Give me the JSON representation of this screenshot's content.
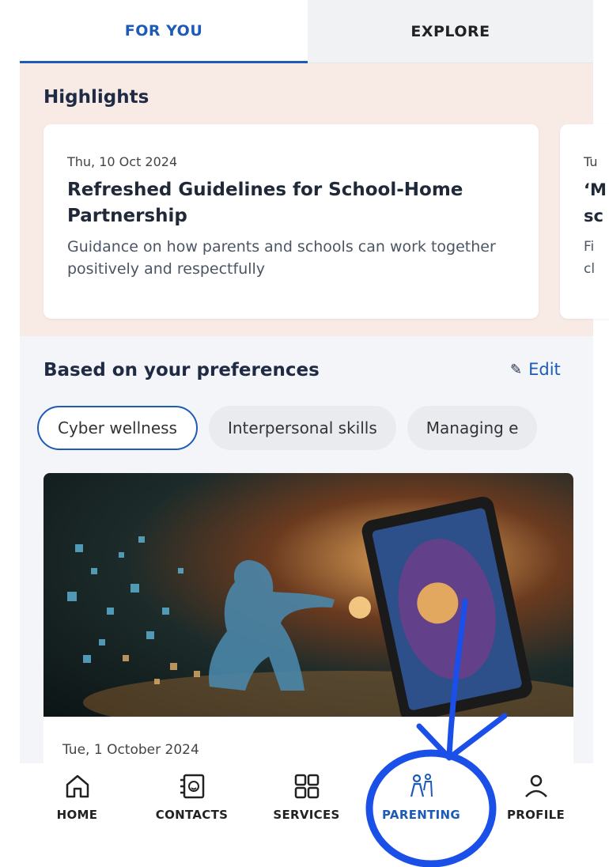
{
  "tabs": [
    {
      "label": "FOR YOU",
      "active": true
    },
    {
      "label": "EXPLORE",
      "active": false
    }
  ],
  "highlights": {
    "title": "Highlights",
    "cards": [
      {
        "date": "Thu, 10 Oct 2024",
        "headline": "Refreshed Guidelines for School-Home Partnership",
        "description": "Guidance on how parents and schools can work together positively and respectfully"
      },
      {
        "date": "Tu",
        "headline": "‘M sc",
        "description": "Fi cl"
      }
    ]
  },
  "preferences": {
    "title": "Based on your preferences",
    "edit_label": "Edit",
    "chips": [
      {
        "label": "Cyber wellness",
        "active": true
      },
      {
        "label": "Interpersonal skills",
        "active": false
      },
      {
        "label": "Managing e",
        "active": false
      }
    ],
    "article": {
      "date": "Tue, 1 October 2024"
    }
  },
  "bottom_nav": [
    {
      "label": "HOME",
      "icon": "home-icon"
    },
    {
      "label": "CONTACTS",
      "icon": "contacts-icon"
    },
    {
      "label": "SERVICES",
      "icon": "services-grid-icon"
    },
    {
      "label": "PARENTING",
      "icon": "parenting-icon",
      "active": true
    },
    {
      "label": "PROFILE",
      "icon": "profile-icon"
    }
  ],
  "colors": {
    "accent": "#1d5bb6",
    "annotation": "#1a4fe8",
    "highlight_bg": "#f8ebe6"
  }
}
